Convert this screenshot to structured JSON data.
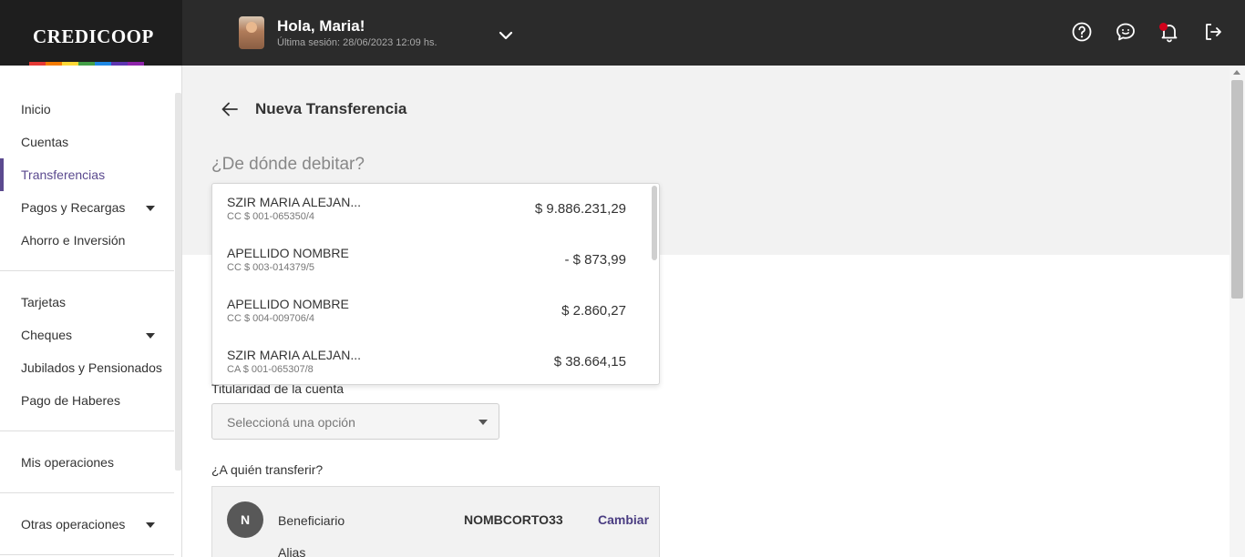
{
  "brand": {
    "name": "CREDICOOP",
    "rainbow_colors": [
      "#e53935",
      "#f57c00",
      "#fdd835",
      "#43a047",
      "#1e88e5",
      "#5e35b1",
      "#8e24aa"
    ]
  },
  "header": {
    "greeting": "Hola, Maria!",
    "last_session": "Última sesión: 28/06/2023 12:09 hs.",
    "icons": [
      "help-icon",
      "chat-icon",
      "bell-icon",
      "logout-icon"
    ]
  },
  "sidebar": {
    "items": [
      {
        "label": "Inicio"
      },
      {
        "label": "Cuentas"
      },
      {
        "label": "Transferencias",
        "active": true
      },
      {
        "label": "Pagos y Recargas",
        "expandable": true
      },
      {
        "label": "Ahorro e Inversión"
      },
      {
        "label": "Tarjetas"
      },
      {
        "label": "Cheques",
        "expandable": true
      },
      {
        "label": "Jubilados y Pensionados"
      },
      {
        "label": "Pago de Haberes"
      },
      {
        "label": "Mis operaciones"
      },
      {
        "label": "Otras operaciones",
        "expandable": true
      }
    ]
  },
  "main": {
    "title": "Nueva Transferencia",
    "debit_question": "¿De dónde debitar?",
    "accounts": [
      {
        "name": "SZIR MARIA ALEJAN...",
        "number": "CC $ 001-065350/4",
        "balance": "$ 9.886.231,29"
      },
      {
        "name": "APELLIDO NOMBRE",
        "number": "CC $ 003-014379/5",
        "balance": "- $ 873,99"
      },
      {
        "name": "APELLIDO NOMBRE",
        "number": "CC $ 004-009706/4",
        "balance": "$ 2.860,27"
      },
      {
        "name": "SZIR MARIA ALEJAN...",
        "number": "CA $ 001-065307/8",
        "balance": "$ 38.664,15"
      }
    ],
    "titularidad_label": "Titularidad de la cuenta",
    "titularidad_placeholder": "Seleccioná una opción",
    "recipient_question": "¿A quién transferir?",
    "beneficiary": {
      "initial": "N",
      "label": "Beneficiario",
      "name": "NOMBCORTO33",
      "change_label": "Cambiar",
      "alias_label": "Alias"
    }
  },
  "colors": {
    "accent": "#5b4a8f",
    "link": "#4a3d82",
    "header_bg": "#2b2b2b",
    "notification": "#d0021b"
  }
}
